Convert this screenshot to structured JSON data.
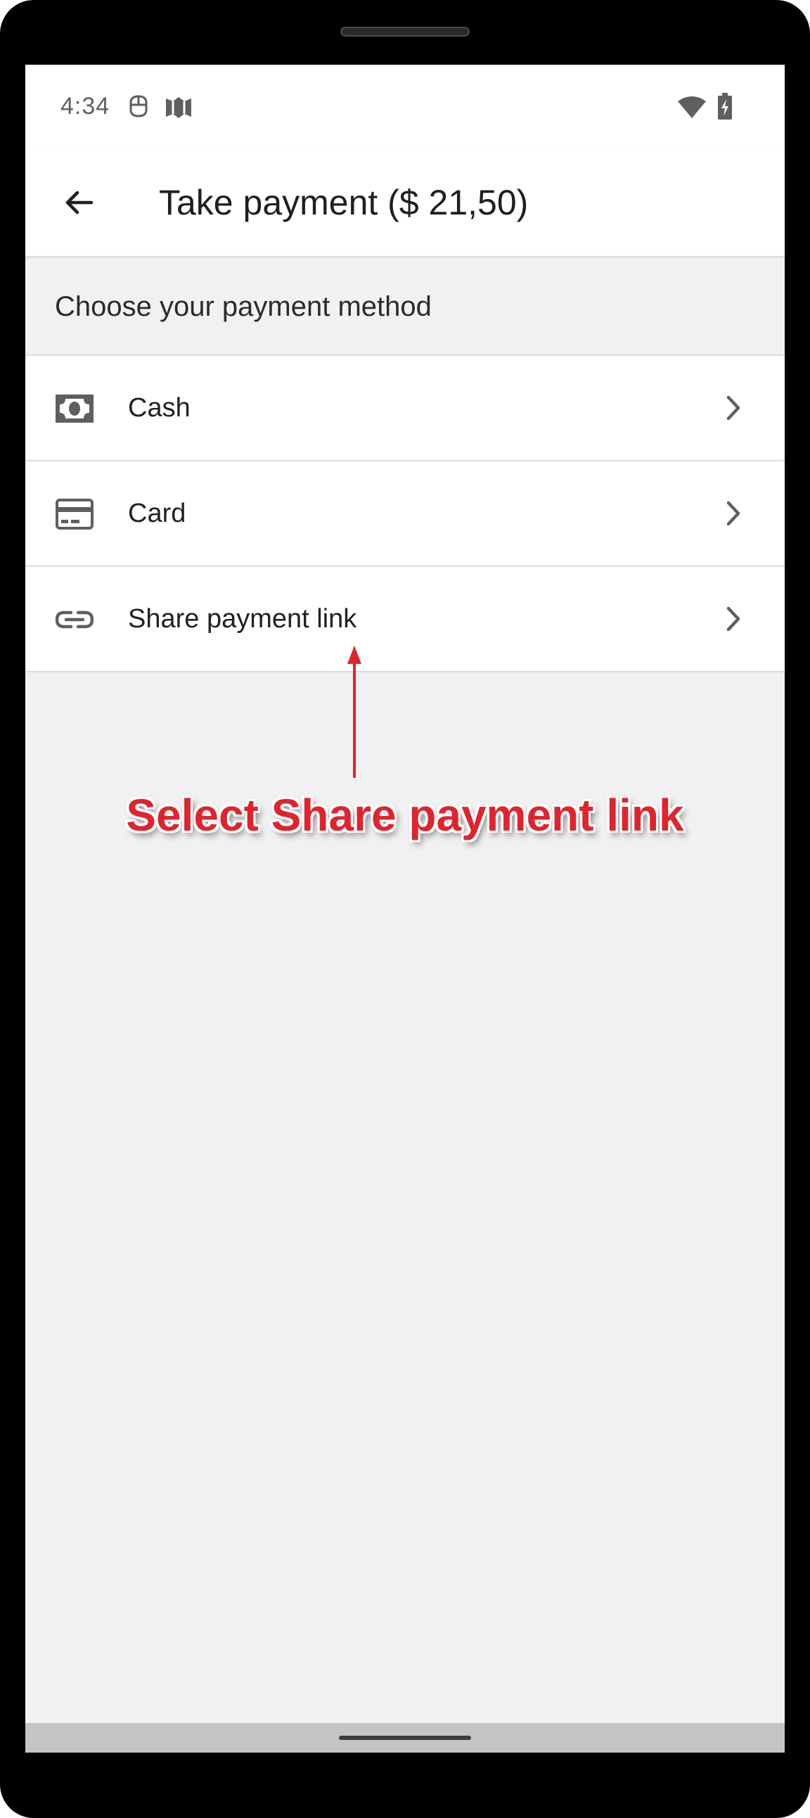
{
  "status_bar": {
    "time": "4:34",
    "left_icons": [
      "android-debug-icon",
      "app-notification-icon"
    ],
    "right_icons": [
      "wifi-icon",
      "battery-charging-icon"
    ]
  },
  "app_bar": {
    "title": "Take payment ($ 21,50)",
    "back_icon": "arrow-back-icon"
  },
  "section": {
    "header": "Choose your payment method"
  },
  "payment_methods": [
    {
      "label": "Cash",
      "icon": "cash-icon"
    },
    {
      "label": "Card",
      "icon": "credit-card-icon"
    },
    {
      "label": "Share payment link",
      "icon": "link-icon"
    }
  ],
  "annotation": {
    "text": "Select Share payment link",
    "color": "#e0242d"
  },
  "colors": {
    "background": "#f1f1f1",
    "surface": "#ffffff",
    "icon": "#5f5f5f",
    "text": "#1f1f1f"
  }
}
